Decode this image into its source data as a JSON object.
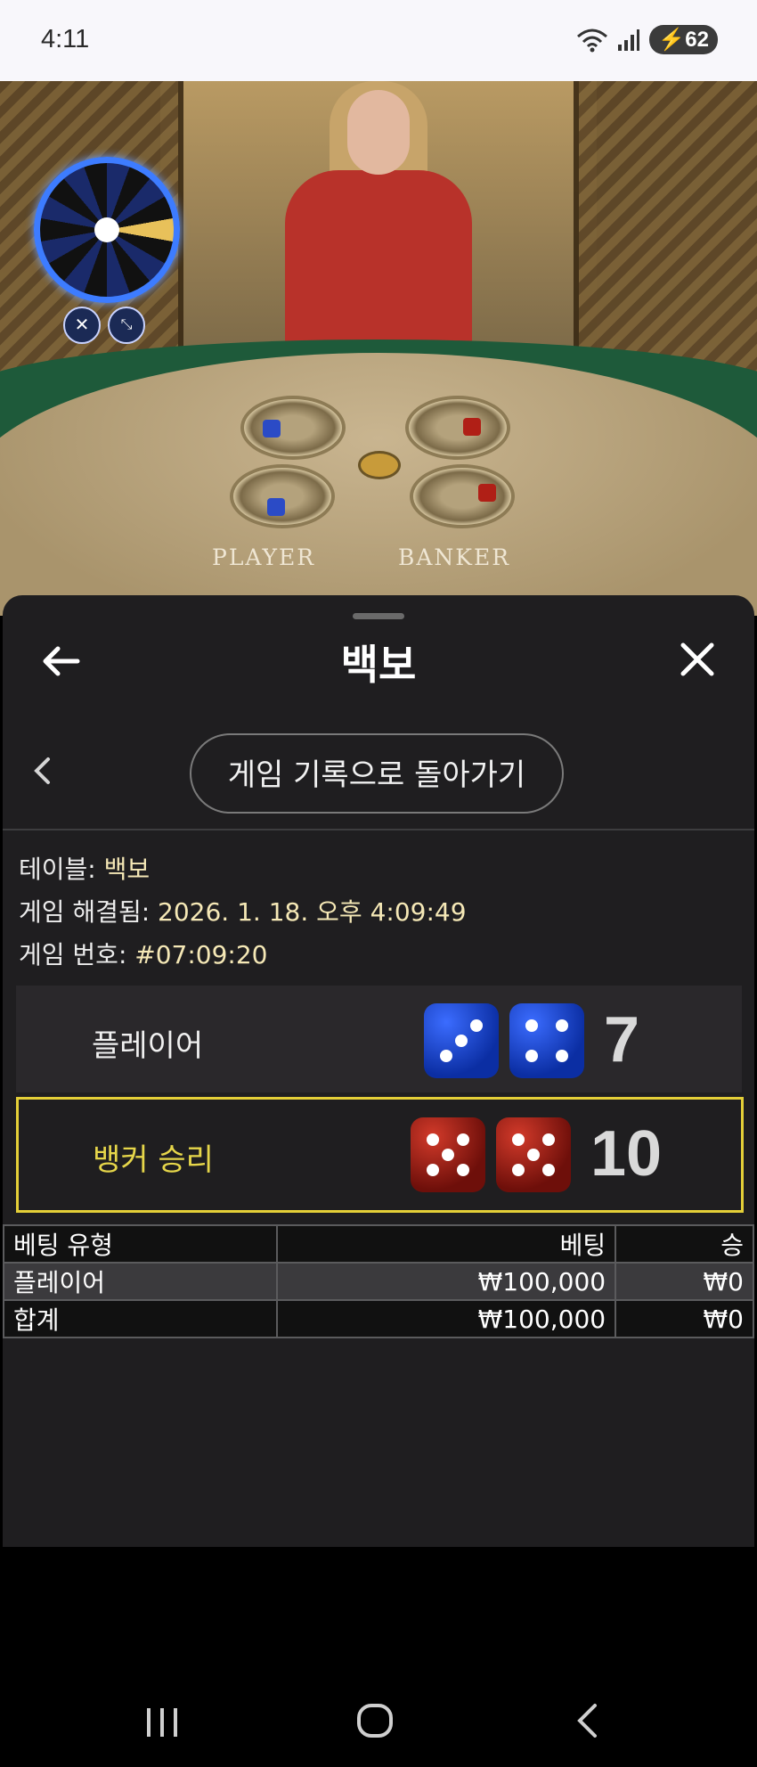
{
  "status_bar": {
    "time": "4:11",
    "battery": "62"
  },
  "video": {
    "table_labels": {
      "player": "PLAYER",
      "banker": "BANKER"
    }
  },
  "sheet": {
    "title": "백보",
    "history_button": "게임 기록으로 돌아가기",
    "info": [
      {
        "label": "테이블: ",
        "value": "백보"
      },
      {
        "label": "게임 해결됨: ",
        "value": "2026. 1. 18. 오후 4:09:49"
      },
      {
        "label": "게임 번호: ",
        "value": "#07:09:20"
      }
    ],
    "results": {
      "player": {
        "label": "플레이어",
        "dice": [
          3,
          4
        ],
        "score": "7",
        "color": "#0b2ea3"
      },
      "banker": {
        "label": "뱅커 승리",
        "dice": [
          5,
          5
        ],
        "score": "10",
        "color": "#e4cf38"
      }
    },
    "bets_table": {
      "headers": [
        "베팅 유형",
        "베팅",
        "승"
      ],
      "rows": [
        [
          "플레이어",
          "₩100,000",
          "₩0"
        ],
        [
          "합계",
          "₩100,000",
          "₩0"
        ]
      ]
    }
  },
  "icons": {
    "back": "arrow-left-icon",
    "close": "close-icon",
    "chevron": "chevron-left-icon"
  }
}
